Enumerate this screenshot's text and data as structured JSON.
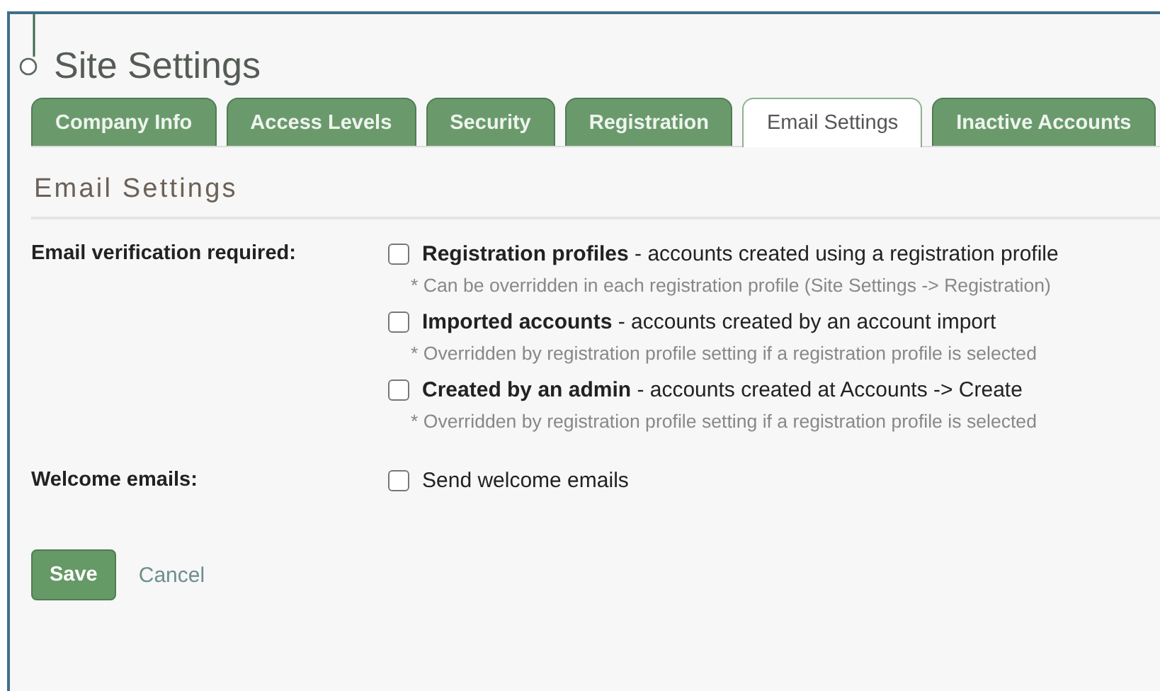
{
  "page_title": "Site Settings",
  "tabs": [
    {
      "label": "Company Info",
      "selected": false
    },
    {
      "label": "Access Levels",
      "selected": false
    },
    {
      "label": "Security",
      "selected": false
    },
    {
      "label": "Registration",
      "selected": false
    },
    {
      "label": "Email Settings",
      "selected": true
    },
    {
      "label": "Inactive Accounts",
      "selected": false
    }
  ],
  "section_title": "Email Settings",
  "fields": [
    {
      "label": "Email verification required:",
      "options": [
        {
          "text": "**Registration profiles** - accounts created using a registration profile",
          "checked": false,
          "note": "* Can be overridden in each registration profile (Site Settings -> Registration)"
        },
        {
          "text": "**Imported accounts** - accounts created by an account import",
          "checked": false,
          "note": "* Overridden by registration profile setting if a registration profile is selected"
        },
        {
          "text": "**Created by an admin** - accounts created at Accounts -> Create",
          "checked": false,
          "note": "* Overridden by registration profile setting if a registration profile is selected"
        }
      ]
    },
    {
      "label": "Welcome emails:",
      "options": [
        {
          "text": "Send welcome emails",
          "checked": false
        }
      ]
    }
  ],
  "buttons": {
    "save": "Save",
    "cancel": "Cancel"
  }
}
